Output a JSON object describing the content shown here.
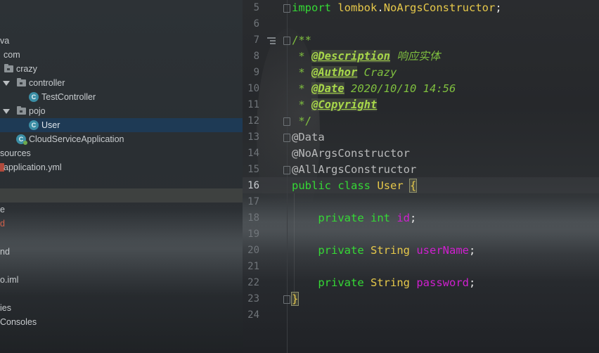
{
  "tree": {
    "items": [
      {
        "label": "va"
      },
      {
        "label": "com"
      },
      {
        "label": "crazy"
      },
      {
        "label": "controller"
      },
      {
        "label": "TestController"
      },
      {
        "label": "pojo"
      },
      {
        "label": "User"
      },
      {
        "label": "CloudServiceApplication"
      },
      {
        "label": "sources"
      },
      {
        "label": "application.yml"
      },
      {
        "label": "e"
      },
      {
        "label": "d"
      },
      {
        "label": "nd"
      },
      {
        "label": "o.iml"
      },
      {
        "label": "ies"
      },
      {
        "label": "Consoles"
      }
    ]
  },
  "editor": {
    "line_numbers": [
      "5",
      "6",
      "7",
      "8",
      "9",
      "10",
      "11",
      "12",
      "13",
      "14",
      "15",
      "16",
      "17",
      "18",
      "19",
      "20",
      "21",
      "22",
      "23",
      "24"
    ],
    "active_line": "16",
    "lines": {
      "l5": {
        "kw": "import",
        "pkg": "lombok",
        "dot": ".",
        "cls": "NoArgsConstructor",
        "semi": ";"
      },
      "l7": "/**",
      "l8": {
        "star": " * ",
        "tag": "@Description",
        "text": " 响应实体"
      },
      "l9": {
        "star": " * ",
        "tag": "@Author",
        "text": " Crazy"
      },
      "l10": {
        "star": " * ",
        "tag": "@Date",
        "text": " 2020/10/10 14:56"
      },
      "l11": {
        "star": " * ",
        "tag": "@Copyright"
      },
      "l12": " */",
      "l13": "@Data",
      "l14": "@NoArgsConstructor",
      "l15": "@AllArgsConstructor",
      "l16": {
        "kw1": "public",
        "kw2": "class",
        "cls": "User",
        "brace": "{"
      },
      "l18": {
        "kw1": "private",
        "kw2": "int",
        "fld": "id",
        "semi": ";"
      },
      "l20": {
        "kw1": "private",
        "cls": "String",
        "fld": "userName",
        "semi": ";"
      },
      "l22": {
        "kw1": "private",
        "cls": "String",
        "fld": "password",
        "semi": ";"
      },
      "l23": "}"
    }
  },
  "colors": {
    "keyword": "#35d935",
    "class": "#e6c84a",
    "field": "#d01fd0",
    "comment": "#7fbf3f",
    "selection": "#1e3a55"
  }
}
